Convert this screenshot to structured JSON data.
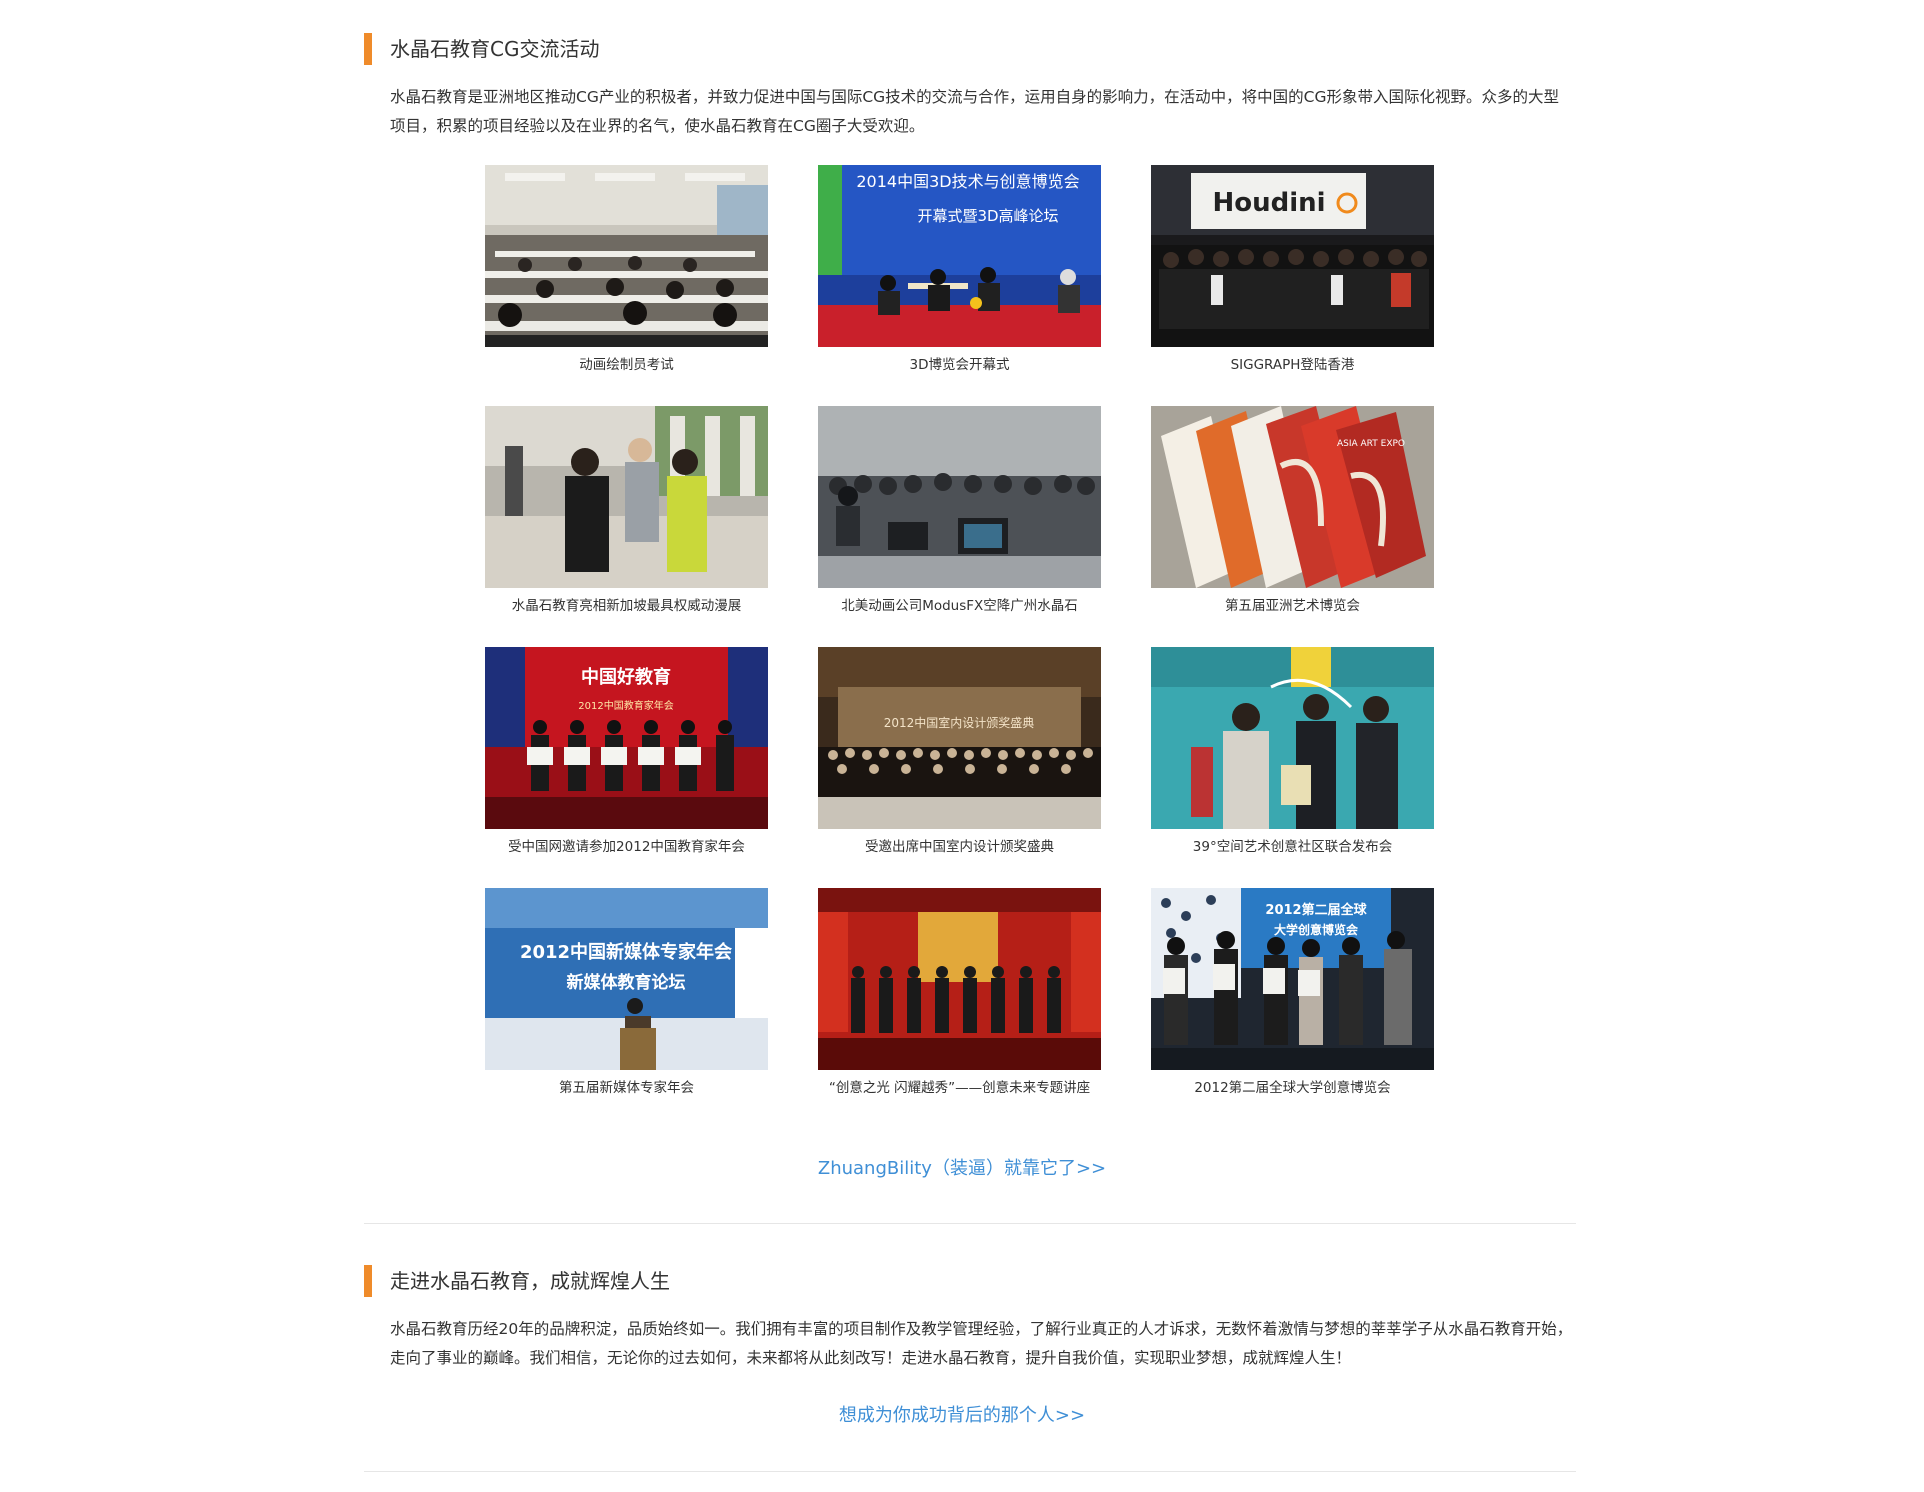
{
  "colors": {
    "accent_bar": "#ef8b2a",
    "link": "#3f8fd6",
    "divider": "#e6e6e6"
  },
  "section1": {
    "title": "水晶石教育CG交流活动",
    "description": "水晶石教育是亚洲地区推动CG产业的积极者，并致力促进中国与国际CG技术的交流与合作，运用自身的影响力，在活动中，将中国的CG形象带入国际化视野。众多的大型项目，积累的项目经验以及在业界的名气，使水晶石教育在CG圈子大受欢迎。",
    "gallery": [
      {
        "caption": "动画绘制员考试"
      },
      {
        "caption": "3D博览会开幕式",
        "banner_text": "2014中国3D技术与创意博览会",
        "banner_sub": "开幕式暨3D高峰论坛"
      },
      {
        "caption": "SIGGRAPH登陆香港",
        "sign_text": "Houdini"
      },
      {
        "caption": "水晶石教育亮相新加坡最具权威动漫展"
      },
      {
        "caption": "北美动画公司ModusFX空降广州水晶石"
      },
      {
        "caption": "第五届亚洲艺术博览会",
        "brochure_text": "ASIA ART EXPO"
      },
      {
        "caption": "受中国网邀请参加2012中国教育家年会",
        "banner_text": "中国好教育",
        "banner_sub": "2012中国教育家年会"
      },
      {
        "caption": "受邀出席中国室内设计颁奖盛典",
        "banner_text": "2012中国室内设计颁奖盛典"
      },
      {
        "caption": "39°空间艺术创意社区联合发布会"
      },
      {
        "caption": "第五届新媒体专家年会",
        "banner_text": "2012中国新媒体专家年会",
        "banner_sub": "新媒体教育论坛"
      },
      {
        "caption": "“创意之光 闪耀越秀”——创意未来专题讲座"
      },
      {
        "caption": "2012第二届全球大学创意博览会",
        "banner_text": "2012第二届全球",
        "banner_sub": "大学创意博览会"
      }
    ],
    "more_link": "ZhuangBility（装逼）就靠它了>>"
  },
  "section2": {
    "title": "走进水晶石教育，成就辉煌人生",
    "description": "水晶石教育历经20年的品牌积淀，品质始终如一。我们拥有丰富的项目制作及教学管理经验，了解行业真正的人才诉求，无数怀着激情与梦想的莘莘学子从水晶石教育开始，走向了事业的巅峰。我们相信，无论你的过去如何，未来都将从此刻改写！走进水晶石教育，提升自我价值，实现职业梦想，成就辉煌人生！",
    "more_link": "想成为你成功背后的那个人>>"
  }
}
